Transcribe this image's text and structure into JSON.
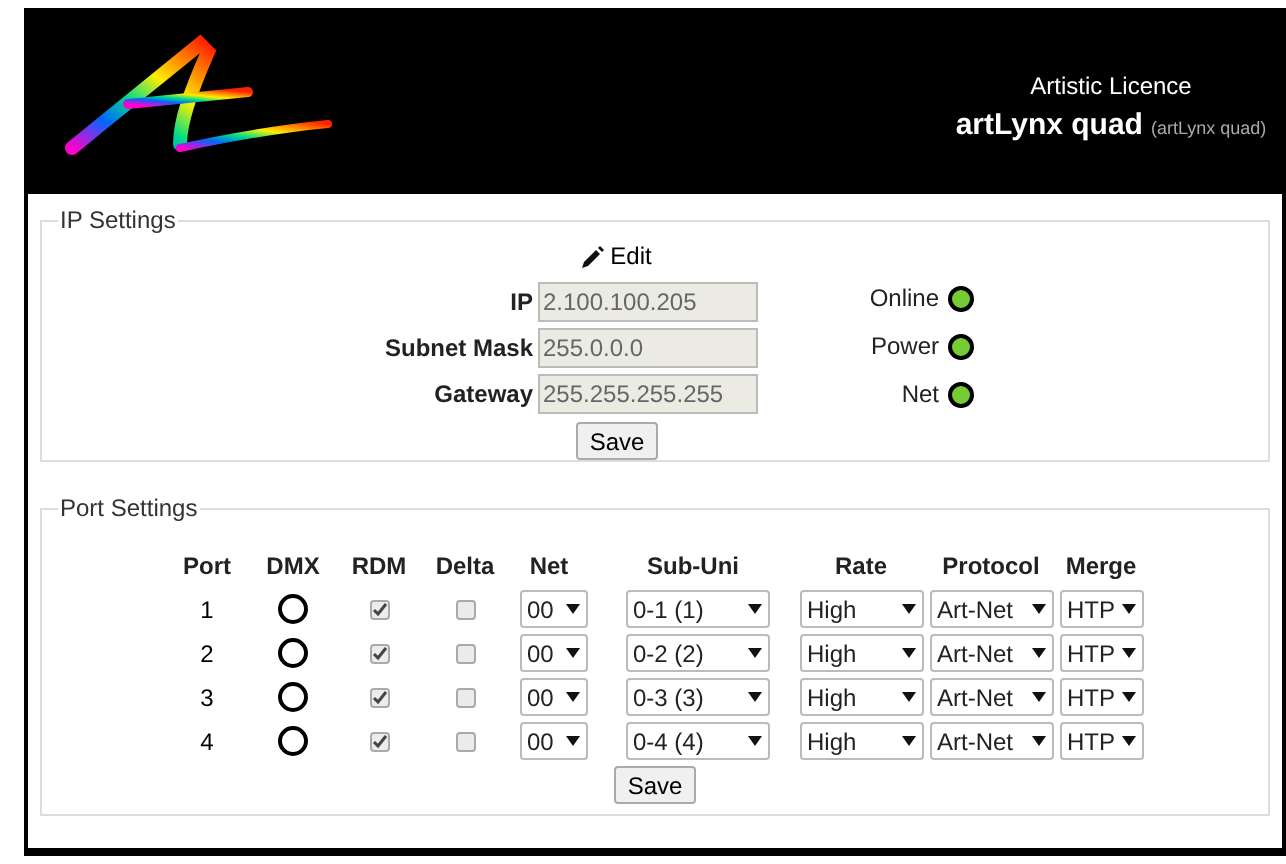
{
  "header": {
    "company": "Artistic Licence",
    "product": "artLynx quad",
    "product_note": "(artLynx quad)"
  },
  "ip_settings": {
    "legend": "IP Settings",
    "edit": "Edit",
    "fields": [
      {
        "label": "IP",
        "value": "2.100.100.205"
      },
      {
        "label": "Subnet Mask",
        "value": "255.0.0.0"
      },
      {
        "label": "Gateway",
        "value": "255.255.255.255"
      }
    ],
    "status": [
      {
        "label": "Online",
        "on": true
      },
      {
        "label": "Power",
        "on": true
      },
      {
        "label": "Net",
        "on": true
      }
    ],
    "save": "Save"
  },
  "port_settings": {
    "legend": "Port Settings",
    "columns": [
      "Port",
      "DMX",
      "RDM",
      "Delta",
      "Net",
      "Sub-Uni",
      "Rate",
      "Protocol",
      "Merge"
    ],
    "rows": [
      {
        "port": "1",
        "dmx_on": false,
        "rdm": true,
        "delta": false,
        "net": "00",
        "sub_uni": "0-1 (1)",
        "rate": "High",
        "protocol": "Art-Net",
        "merge": "HTP"
      },
      {
        "port": "2",
        "dmx_on": false,
        "rdm": true,
        "delta": false,
        "net": "00",
        "sub_uni": "0-2 (2)",
        "rate": "High",
        "protocol": "Art-Net",
        "merge": "HTP"
      },
      {
        "port": "3",
        "dmx_on": false,
        "rdm": true,
        "delta": false,
        "net": "00",
        "sub_uni": "0-3 (3)",
        "rate": "High",
        "protocol": "Art-Net",
        "merge": "HTP"
      },
      {
        "port": "4",
        "dmx_on": false,
        "rdm": true,
        "delta": false,
        "net": "00",
        "sub_uni": "0-4 (4)",
        "rate": "High",
        "protocol": "Art-Net",
        "merge": "HTP"
      }
    ],
    "save": "Save"
  }
}
